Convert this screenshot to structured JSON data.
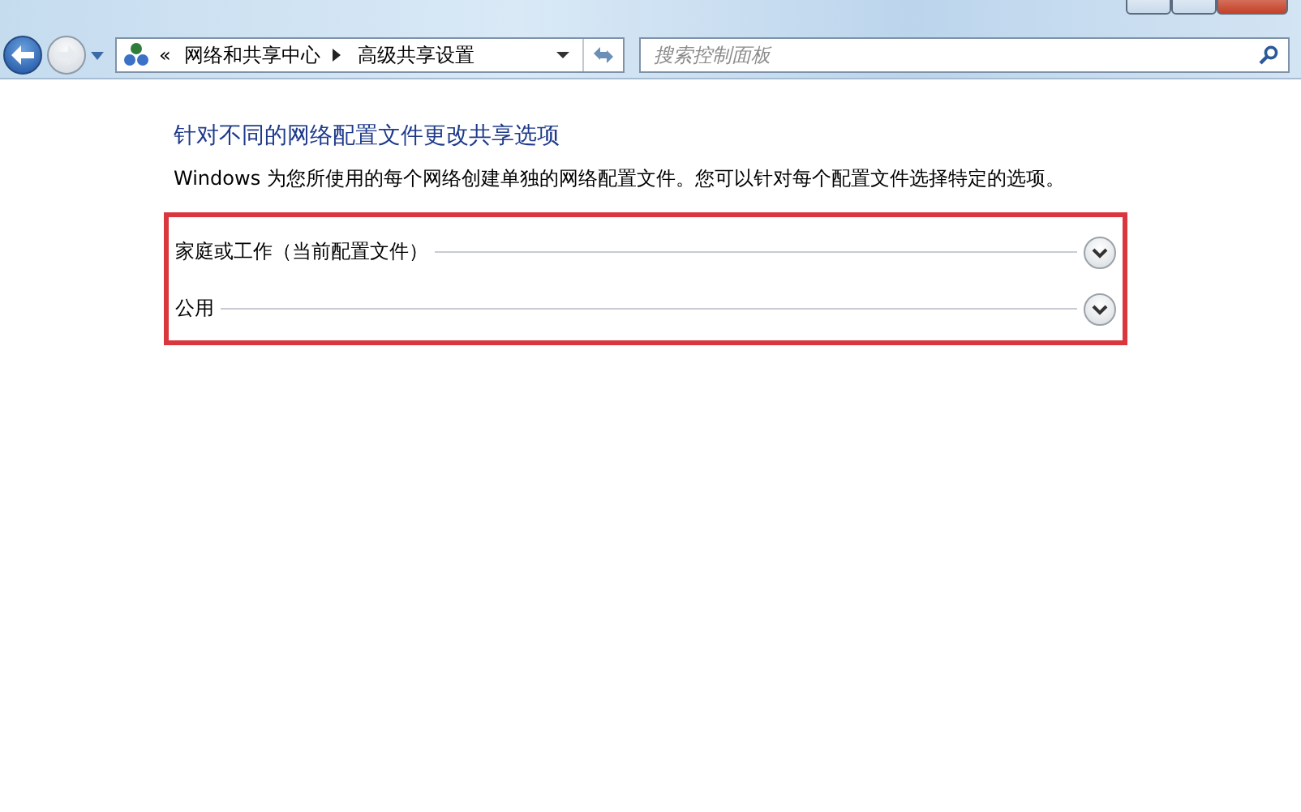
{
  "address_bar": {
    "overflow": "«",
    "crumbs": [
      "网络和共享中心",
      "高级共享设置"
    ]
  },
  "search": {
    "placeholder": "搜索控制面板"
  },
  "heading": "针对不同的网络配置文件更改共享选项",
  "description": "Windows 为您所使用的每个网络创建单独的网络配置文件。您可以针对每个配置文件选择特定的选项。",
  "profiles": [
    {
      "label": "家庭或工作（当前配置文件）",
      "expanded": false
    },
    {
      "label": "公用",
      "expanded": false
    }
  ]
}
